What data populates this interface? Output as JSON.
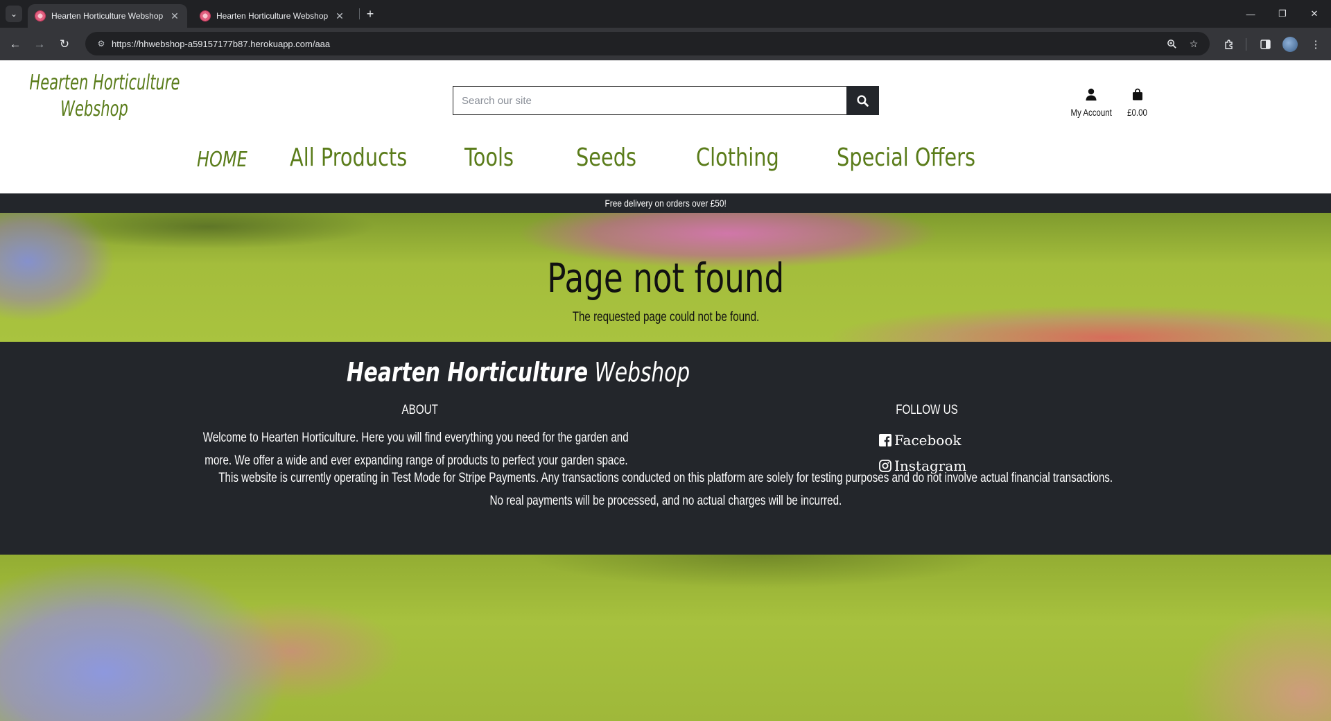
{
  "browser": {
    "tabs": [
      {
        "title": "Hearten Horticulture Webshop",
        "active": true
      },
      {
        "title": "Hearten Horticulture Webshop",
        "active": false
      }
    ],
    "url": "https://hhwebshop-a59157177b87.herokuapp.com/aaa"
  },
  "site": {
    "logo_line1": "Hearten Horticulture",
    "logo_line2": "Webshop",
    "search_placeholder": "Search our site",
    "account_label": "My Account",
    "cart_total": "£0.00",
    "nav": [
      "HOME",
      "All Products",
      "Tools",
      "Seeds",
      "Clothing",
      "Special Offers"
    ],
    "banner": "Free delivery on orders over £50!"
  },
  "hero": {
    "title": "Page not found",
    "subtitle": "The requested page could not be found."
  },
  "footer": {
    "logo_bold": "Hearten Horticulture",
    "logo_light": "Webshop",
    "about_heading": "ABOUT",
    "about_line1": "Welcome to Hearten Horticulture. Here you will find everything you need for the garden and",
    "about_line2": "more. We offer a wide and ever expanding range of products to perfect your garden space.",
    "follow_heading": "FOLLOW US",
    "facebook": "Facebook",
    "instagram": "Instagram",
    "test_line1": "This website is currently operating in Test Mode for Stripe Payments. Any transactions conducted on this platform are solely for testing purposes and do not involve actual financial transactions.",
    "test_line2": "No real payments will be processed, and no actual charges will be incurred."
  },
  "colors": {
    "brand_green": "#5a7c1a",
    "dark": "#23262b"
  }
}
